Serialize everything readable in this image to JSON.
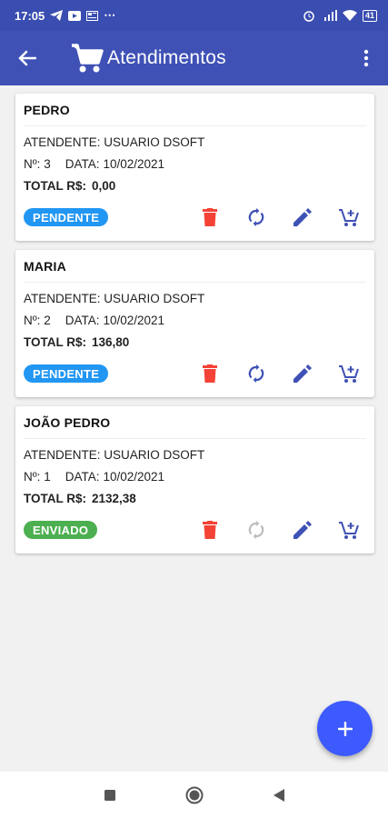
{
  "status_bar": {
    "time": "17:05",
    "battery": "41"
  },
  "app_bar": {
    "title": "Atendimentos"
  },
  "colors": {
    "primary": "#3f51b5",
    "pendente": "#2196f3",
    "enviado": "#4caf50",
    "delete": "#f44336",
    "icon": "#3f51b5",
    "fab": "#3d5afe"
  },
  "labels": {
    "attendant": "ATENDENTE:",
    "number": "Nº:",
    "date": "DATA:",
    "total": "TOTAL R$:"
  },
  "orders": [
    {
      "name": "PEDRO",
      "attendant": "USUARIO DSOFT",
      "number": "3",
      "date": "10/02/2021",
      "total": "0,00",
      "status": "PENDENTE",
      "sync_enabled": true
    },
    {
      "name": "MARIA",
      "attendant": "USUARIO DSOFT",
      "number": "2",
      "date": "10/02/2021",
      "total": "136,80",
      "status": "PENDENTE",
      "sync_enabled": true
    },
    {
      "name": "JOÃO PEDRO",
      "attendant": "USUARIO DSOFT",
      "number": "1",
      "date": "10/02/2021",
      "total": "2132,38",
      "status": "ENVIADO",
      "sync_enabled": false
    }
  ],
  "icons": {
    "back": "arrow-left-icon",
    "cart": "shopping-cart-icon",
    "menu": "more-vert-icon",
    "delete": "trash-icon",
    "sync": "sync-icon",
    "edit": "pencil-icon",
    "add_item": "cart-plus-icon",
    "fab": "plus-icon"
  }
}
